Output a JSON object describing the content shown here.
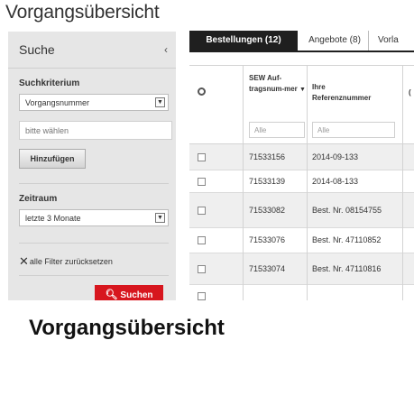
{
  "page": {
    "title": "Vorgangsübersicht",
    "caption": "Vorgangsübersicht"
  },
  "sidebar": {
    "title": "Suche",
    "collapse_icon": "chevron-left-icon",
    "criteria_label": "Suchkriterium",
    "criteria_value": "Vorgangsnummer",
    "search_placeholder": "bitte wählen",
    "add_button": "Hinzufügen",
    "period_label": "Zeitraum",
    "period_value": "letzte 3 Monate",
    "reset_label": "alle Filter zurücksetzen",
    "reset_icon": "close-icon",
    "search_button": "Suchen",
    "search_icon": "search-icon",
    "accent_color": "#d7161e"
  },
  "tabs": [
    {
      "label": "Bestellungen (12)",
      "active": true
    },
    {
      "label": "Angebote (8)",
      "active": false
    },
    {
      "label": "Vorla",
      "active": false
    }
  ],
  "table": {
    "columns": [
      {
        "label": ""
      },
      {
        "label": "SEW Auf-tragsnum-mer"
      },
      {
        "label": "Ihre Referenznummer"
      },
      {
        "label": "("
      }
    ],
    "filters": [
      "Alle",
      "Alle"
    ],
    "rows": [
      {
        "order": "71533156",
        "reference": "2014-09-133"
      },
      {
        "order": "71533139",
        "reference": "2014-08-133"
      },
      {
        "order": "71533082",
        "reference": "Best. Nr. 08154755"
      },
      {
        "order": "71533076",
        "reference": "Best. Nr. 47110852"
      },
      {
        "order": "71533074",
        "reference": "Best. Nr. 47110816"
      }
    ]
  }
}
